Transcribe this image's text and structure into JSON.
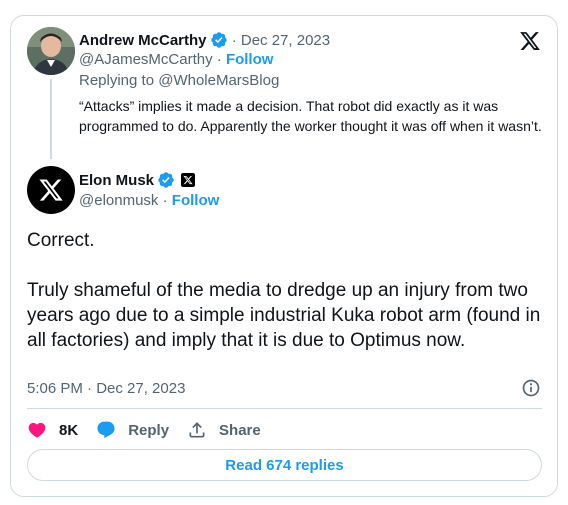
{
  "quoted_tweet": {
    "author_name": "Andrew McCarthy",
    "date": " · Dec 27, 2023",
    "handle": "@AJamesMcCarthy",
    "separator": " · ",
    "follow": "Follow",
    "replying_to": "Replying to @WholeMarsBlog",
    "text": "“Attacks” implies it made a decision. That robot did exactly as it was programmed to do. Apparently the worker thought it was off when it wasn’t."
  },
  "main_tweet": {
    "author_name": "Elon Musk",
    "handle": "@elonmusk",
    "separator": " · ",
    "follow": "Follow",
    "paragraph1": "Correct.",
    "paragraph2": "Truly shameful of the media to dredge up an injury from two years ago due to a simple industrial Kuka robot arm (found in all factories) and imply that it is due to Optimus now.",
    "timestamp": "5:06 PM · Dec 27, 2023"
  },
  "actions": {
    "likes": "8K",
    "reply": "Reply",
    "share": "Share"
  },
  "read_replies": "Read 674 replies",
  "colors": {
    "accent": "#1d9bf0",
    "like": "#f91880",
    "text": "#0f1419",
    "muted": "#536471",
    "border": "#cfd9de"
  }
}
